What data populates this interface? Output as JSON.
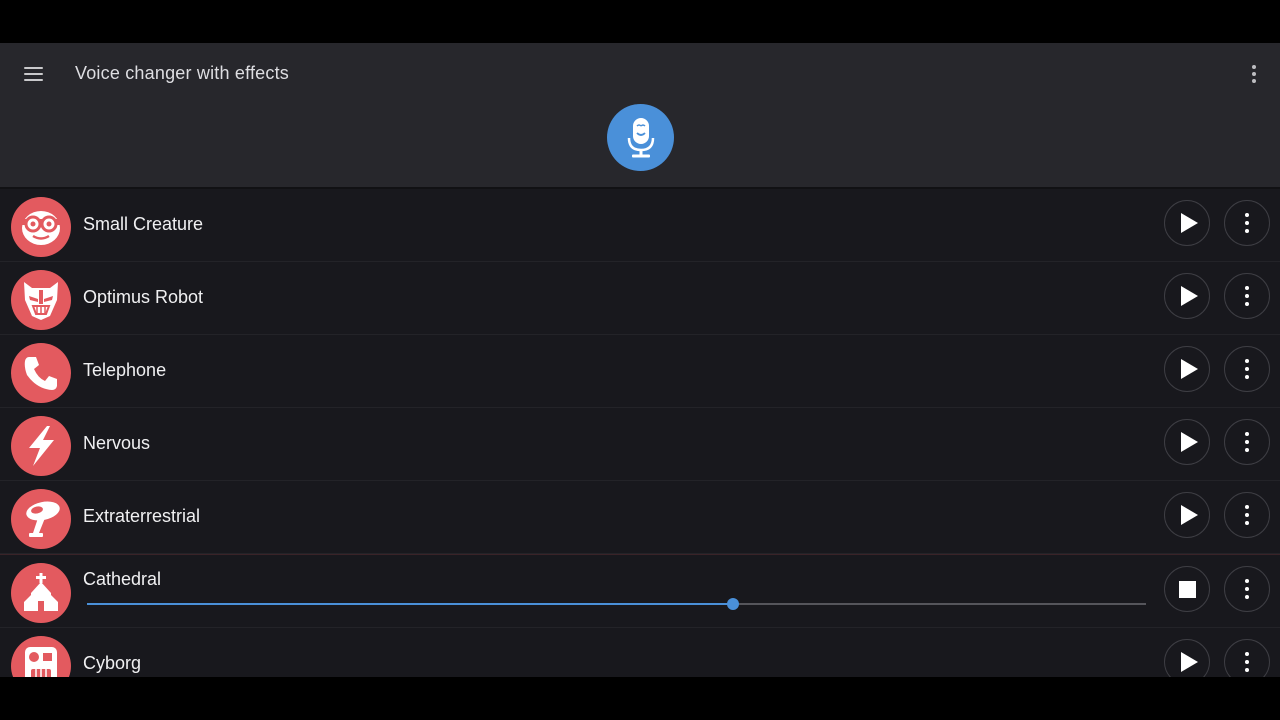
{
  "app": {
    "title": "Voice changer with effects",
    "accent_color": "#4a90d9",
    "effect_avatar_color": "#e35a5f"
  },
  "header": {
    "menu_icon": "hamburger-menu-icon",
    "overflow_icon": "more-vert-icon",
    "record_icon": "microphone-icon"
  },
  "effects": [
    {
      "label": "Small Creature",
      "icon": "creature-face-icon",
      "state": "idle"
    },
    {
      "label": "Optimus Robot",
      "icon": "robot-mask-icon",
      "state": "idle"
    },
    {
      "label": "Telephone",
      "icon": "telephone-icon",
      "state": "idle"
    },
    {
      "label": "Nervous",
      "icon": "lightning-bolt-icon",
      "state": "idle"
    },
    {
      "label": "Extraterrestrial",
      "icon": "ufo-icon",
      "state": "idle"
    },
    {
      "label": "Cathedral",
      "icon": "church-icon",
      "state": "playing",
      "progress": 0.61
    },
    {
      "label": "Cyborg",
      "icon": "cyborg-face-icon",
      "state": "idle"
    }
  ]
}
